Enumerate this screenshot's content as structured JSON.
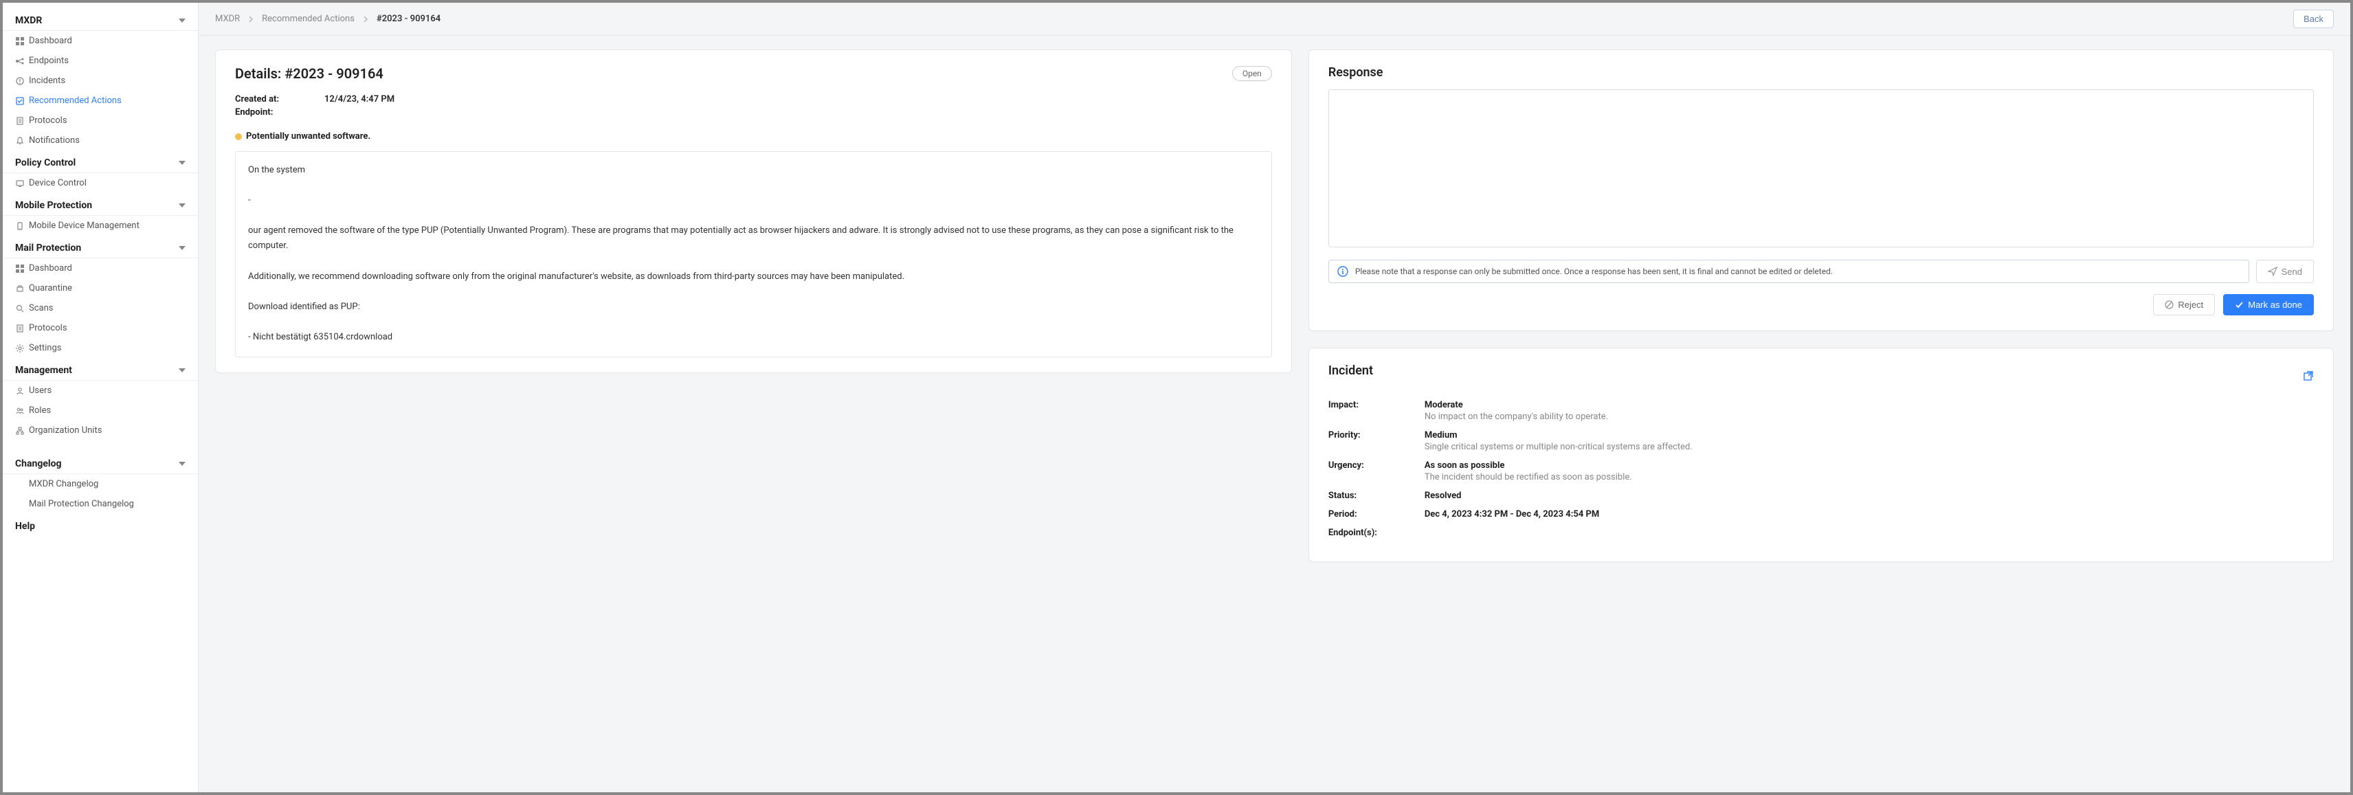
{
  "breadcrumb": {
    "root": "MXDR",
    "section": "Recommended Actions",
    "current": "#2023 - 909164"
  },
  "buttons": {
    "back": "Back",
    "open_pill": "Open",
    "send": "Send",
    "reject": "Reject",
    "mark_done": "Mark as done"
  },
  "sidebar": {
    "sections": [
      {
        "title": "MXDR",
        "items": [
          {
            "label": "Dashboard",
            "icon": "grid-icon"
          },
          {
            "label": "Endpoints",
            "icon": "endpoints-icon"
          },
          {
            "label": "Incidents",
            "icon": "incident-icon"
          },
          {
            "label": "Recommended Actions",
            "icon": "actions-icon",
            "active": true
          },
          {
            "label": "Protocols",
            "icon": "protocol-icon"
          },
          {
            "label": "Notifications",
            "icon": "bell-icon"
          }
        ]
      },
      {
        "title": "Policy Control",
        "items": [
          {
            "label": "Device Control",
            "icon": "device-icon"
          }
        ]
      },
      {
        "title": "Mobile Protection",
        "items": [
          {
            "label": "Mobile Device Management",
            "icon": "mobile-icon"
          }
        ]
      },
      {
        "title": "Mail Protection",
        "items": [
          {
            "label": "Dashboard",
            "icon": "grid-icon"
          },
          {
            "label": "Quarantine",
            "icon": "quarantine-icon"
          },
          {
            "label": "Scans",
            "icon": "scan-icon"
          },
          {
            "label": "Protocols",
            "icon": "protocol-icon"
          },
          {
            "label": "Settings",
            "icon": "gear-icon"
          }
        ]
      },
      {
        "title": "Management",
        "items": [
          {
            "label": "Users",
            "icon": "users-icon"
          },
          {
            "label": "Roles",
            "icon": "roles-icon"
          },
          {
            "label": "Organization Units",
            "icon": "org-icon"
          }
        ]
      },
      {
        "title": "Changelog",
        "items": [
          {
            "label": "MXDR Changelog",
            "icon": ""
          },
          {
            "label": "Mail Protection Changelog",
            "icon": ""
          }
        ]
      },
      {
        "title": "Help",
        "items": []
      }
    ]
  },
  "details": {
    "title": "Details: #2023 - 909164",
    "created_label": "Created at:",
    "created_value": "12/4/23, 4:47 PM",
    "endpoint_label": "Endpoint:",
    "endpoint_value": "",
    "threat_title": "Potentially unwanted software.",
    "body": "On the system\n\n-\n\nour agent removed the software of the type PUP (Potentially Unwanted Program). These are programs that may potentially act as browser hijackers and adware. It is strongly advised not to use these programs, as they can pose a significant risk to the computer.\n\nAdditionally, we recommend downloading software only from the original manufacturer's website, as downloads from third-party sources may have been manipulated.\n\nDownload identified as PUP:\n\n- Nicht bestätigt 635104.crdownload"
  },
  "response": {
    "title": "Response",
    "notice": "Please note that a response can only be submitted once. Once a response has been sent, it is final and cannot be edited or deleted."
  },
  "incident": {
    "title": "Incident",
    "rows": {
      "impact": {
        "label": "Impact:",
        "value": "Moderate",
        "sub": "No impact on the company's ability to operate."
      },
      "priority": {
        "label": "Priority:",
        "value": "Medium",
        "sub": "Single critical systems or multiple non-critical systems are affected."
      },
      "urgency": {
        "label": "Urgency:",
        "value": "As soon as possible",
        "sub": "The incident should be rectified as soon as possible."
      },
      "status": {
        "label": "Status:",
        "value": "Resolved",
        "sub": ""
      },
      "period": {
        "label": "Period:",
        "value": "Dec 4, 2023 4:32 PM - Dec 4, 2023 4:54 PM",
        "sub": ""
      },
      "endpoints": {
        "label": "Endpoint(s):",
        "value": "",
        "sub": ""
      }
    }
  }
}
